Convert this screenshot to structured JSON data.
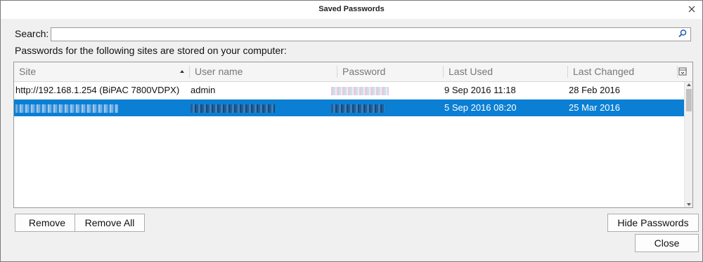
{
  "window": {
    "title": "Saved Passwords"
  },
  "search": {
    "label": "Search:",
    "value": "",
    "placeholder": ""
  },
  "info_text": "Passwords for the following sites are stored on your computer:",
  "table": {
    "columns": [
      "Site",
      "User name",
      "Password",
      "Last Used",
      "Last Changed"
    ],
    "sort_column": "Site",
    "rows": [
      {
        "site": "http://192.168.1.254 (BiPAC 7800VDPX)",
        "username": "admin",
        "password": "",
        "last_used": "9 Sep 2016 11:18",
        "last_changed": "28 Feb 2016",
        "selected": false
      },
      {
        "site": "",
        "username": "",
        "password": "",
        "last_used": "5 Sep 2016 08:20",
        "last_changed": "25 Mar 2016",
        "selected": true
      }
    ]
  },
  "buttons": {
    "remove": "Remove",
    "remove_all": "Remove All",
    "hide_passwords": "Hide Passwords",
    "close": "Close"
  },
  "colors": {
    "selection": "#0a7fd4",
    "background": "#f0f0f0"
  }
}
